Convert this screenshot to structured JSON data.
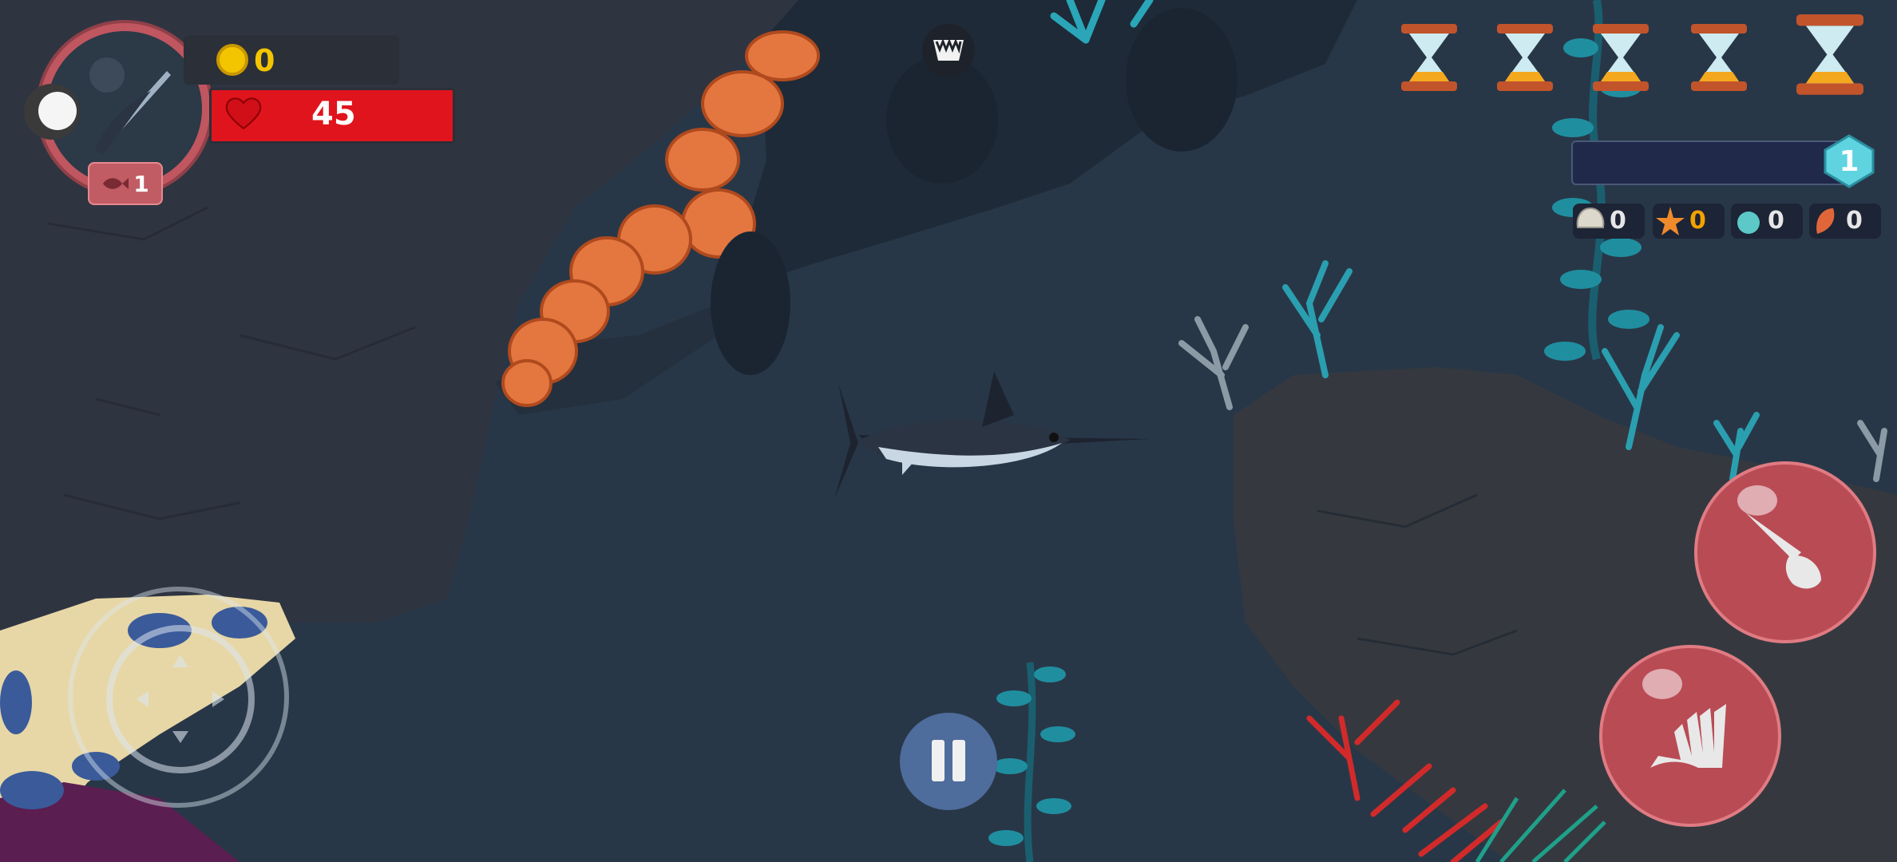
{
  "game": {
    "title": "",
    "hud": {
      "coins": "0",
      "health": "45",
      "player_level": "1",
      "xp_level": "1",
      "xp_progress": 0.0,
      "boosters_count": 5
    },
    "resources": [
      {
        "name": "shell",
        "value": "0",
        "color": "#dcd8cc"
      },
      {
        "name": "starfish",
        "value": "0",
        "color": "#f08a2a"
      },
      {
        "name": "sea-urchin",
        "value": "0",
        "color": "#5cc8c8"
      },
      {
        "name": "conch",
        "value": "0",
        "color": "#e0663a"
      }
    ],
    "controls": {
      "attack_icon": "swordfish-bill-icon",
      "dash_icon": "fin-icon",
      "pause_icon": "pause-icon",
      "threat_icon": "jaws-icon"
    },
    "colors": {
      "water": "#283747",
      "rock": "#2f3441",
      "health": "#e0141c",
      "coin": "#f2c500",
      "button": "#b94b55",
      "pause": "#4e6c9c",
      "xp_gem": "#5fd4e0"
    }
  }
}
